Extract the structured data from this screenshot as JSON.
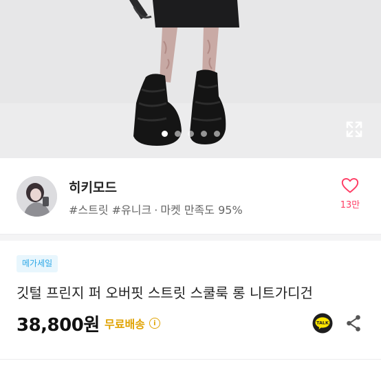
{
  "gallery": {
    "total_images": 5,
    "active_index": 0,
    "expand_icon": "expand-icon"
  },
  "seller": {
    "name": "히키모드",
    "tags": "#스트릿 #유니크",
    "satisfaction": "마켓 만족도 95%",
    "separator": "·",
    "like_count": "13만",
    "like_icon": "heart-icon",
    "accent": "#ff3c64"
  },
  "product": {
    "badge": "메가세일",
    "title": "깃털 프린지 퍼 오버핏 스트릿 스쿨룩 롱 니트가디건",
    "price": "38,800원",
    "shipping": "무료배송",
    "shipping_icon": "info-icon",
    "talk_label": "TALK",
    "share_icon": "share-icon",
    "badge_color": "#2ca7e6",
    "shipping_color": "#e0a200"
  }
}
